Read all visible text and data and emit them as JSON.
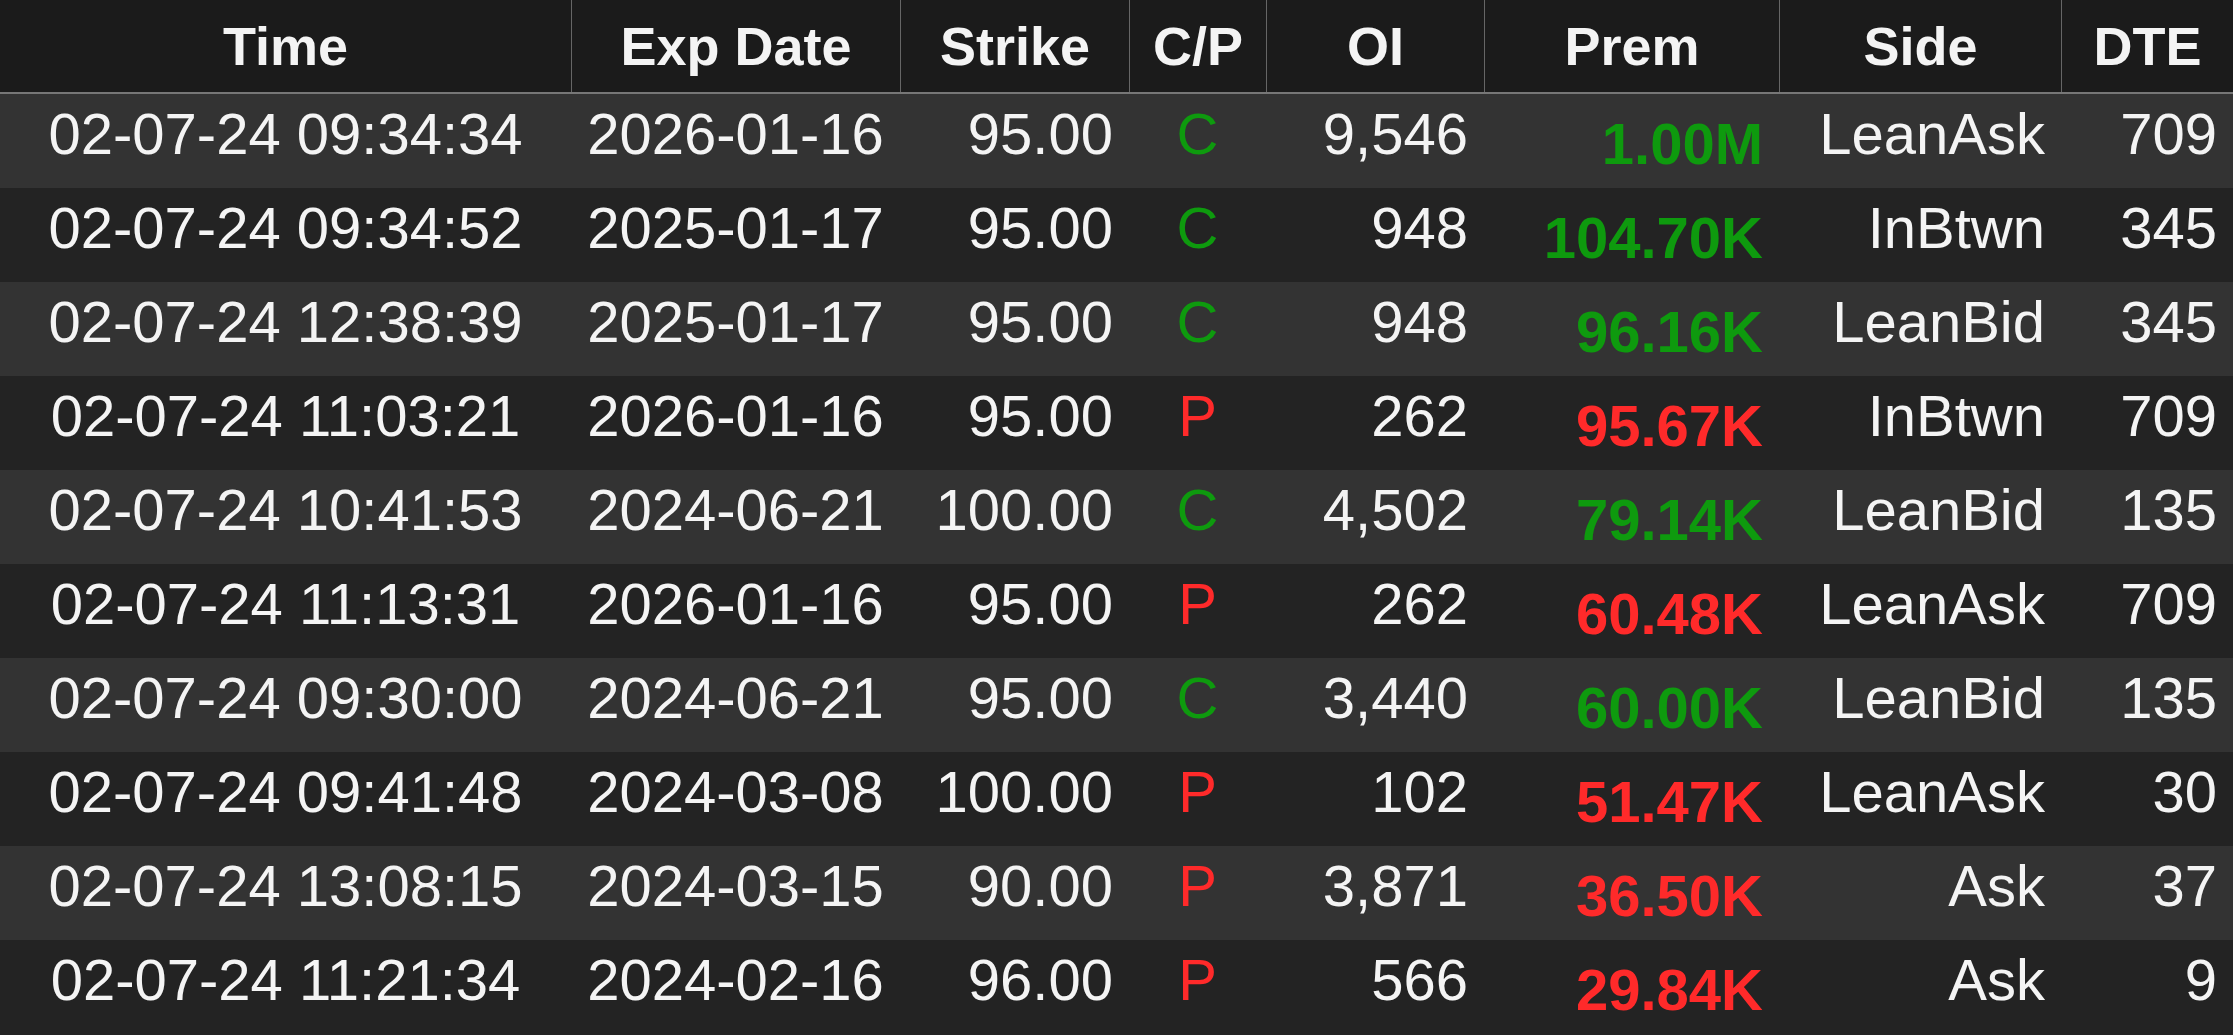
{
  "table": {
    "columns": [
      "Time",
      "Exp Date",
      "Strike",
      "C/P",
      "OI",
      "Prem",
      "Side",
      "DTE"
    ],
    "rows": [
      {
        "time": "02-07-24 09:34:34",
        "exp_date": "2026-01-16",
        "strike": "95.00",
        "cp": "C",
        "oi": "9,546",
        "prem": "1.00M",
        "side": "LeanAsk",
        "dte": "709",
        "color": "#0e9a0e"
      },
      {
        "time": "02-07-24 09:34:52",
        "exp_date": "2025-01-17",
        "strike": "95.00",
        "cp": "C",
        "oi": "948",
        "prem": "104.70K",
        "side": "InBtwn",
        "dte": "345",
        "color": "#0e9a0e"
      },
      {
        "time": "02-07-24 12:38:39",
        "exp_date": "2025-01-17",
        "strike": "95.00",
        "cp": "C",
        "oi": "948",
        "prem": "96.16K",
        "side": "LeanBid",
        "dte": "345",
        "color": "#0e9a0e"
      },
      {
        "time": "02-07-24 11:03:21",
        "exp_date": "2026-01-16",
        "strike": "95.00",
        "cp": "P",
        "oi": "262",
        "prem": "95.67K",
        "side": "InBtwn",
        "dte": "709",
        "color": "#ff2a2a"
      },
      {
        "time": "02-07-24 10:41:53",
        "exp_date": "2024-06-21",
        "strike": "100.00",
        "cp": "C",
        "oi": "4,502",
        "prem": "79.14K",
        "side": "LeanBid",
        "dte": "135",
        "color": "#0e9a0e"
      },
      {
        "time": "02-07-24 11:13:31",
        "exp_date": "2026-01-16",
        "strike": "95.00",
        "cp": "P",
        "oi": "262",
        "prem": "60.48K",
        "side": "LeanAsk",
        "dte": "709",
        "color": "#ff2a2a"
      },
      {
        "time": "02-07-24 09:30:00",
        "exp_date": "2024-06-21",
        "strike": "95.00",
        "cp": "C",
        "oi": "3,440",
        "prem": "60.00K",
        "side": "LeanBid",
        "dte": "135",
        "color": "#0e9a0e"
      },
      {
        "time": "02-07-24 09:41:48",
        "exp_date": "2024-03-08",
        "strike": "100.00",
        "cp": "P",
        "oi": "102",
        "prem": "51.47K",
        "side": "LeanAsk",
        "dte": "30",
        "color": "#ff2a2a"
      },
      {
        "time": "02-07-24 13:08:15",
        "exp_date": "2024-03-15",
        "strike": "90.00",
        "cp": "P",
        "oi": "3,871",
        "prem": "36.50K",
        "side": "Ask",
        "dte": "37",
        "color": "#ff2a2a"
      },
      {
        "time": "02-07-24 11:21:34",
        "exp_date": "2024-02-16",
        "strike": "96.00",
        "cp": "P",
        "oi": "566",
        "prem": "29.84K",
        "side": "Ask",
        "dte": "9",
        "color": "#ff2a2a"
      }
    ]
  }
}
